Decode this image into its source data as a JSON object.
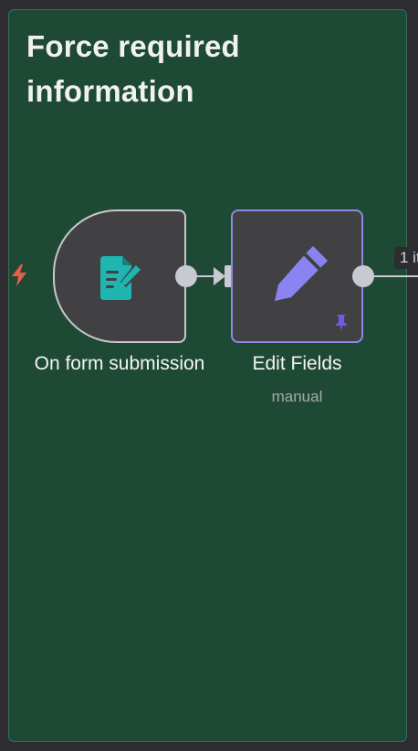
{
  "sticky_note": {
    "title": "Force required information"
  },
  "nodes": {
    "trigger": {
      "label": "On form submission",
      "icon": "form-edit-icon",
      "trigger_icon": "bolt-icon"
    },
    "edit_fields": {
      "label": "Edit Fields",
      "subtitle": "manual",
      "icon": "pencil-icon",
      "pinned_icon": "pin-icon"
    }
  },
  "connection": {
    "items_label": "1 it"
  },
  "colors": {
    "canvas": "#2c2c31",
    "sticky_background": "#1e4a35",
    "node_background": "#414144",
    "trigger_border": "#c8c8cc",
    "edit_border": "#8f89e6",
    "trigger_icon_color": "#1fb5b0",
    "pencil_color": "#8b83f2",
    "bolt_color": "#ea5b4a",
    "pin_color": "#6c5ce7"
  }
}
